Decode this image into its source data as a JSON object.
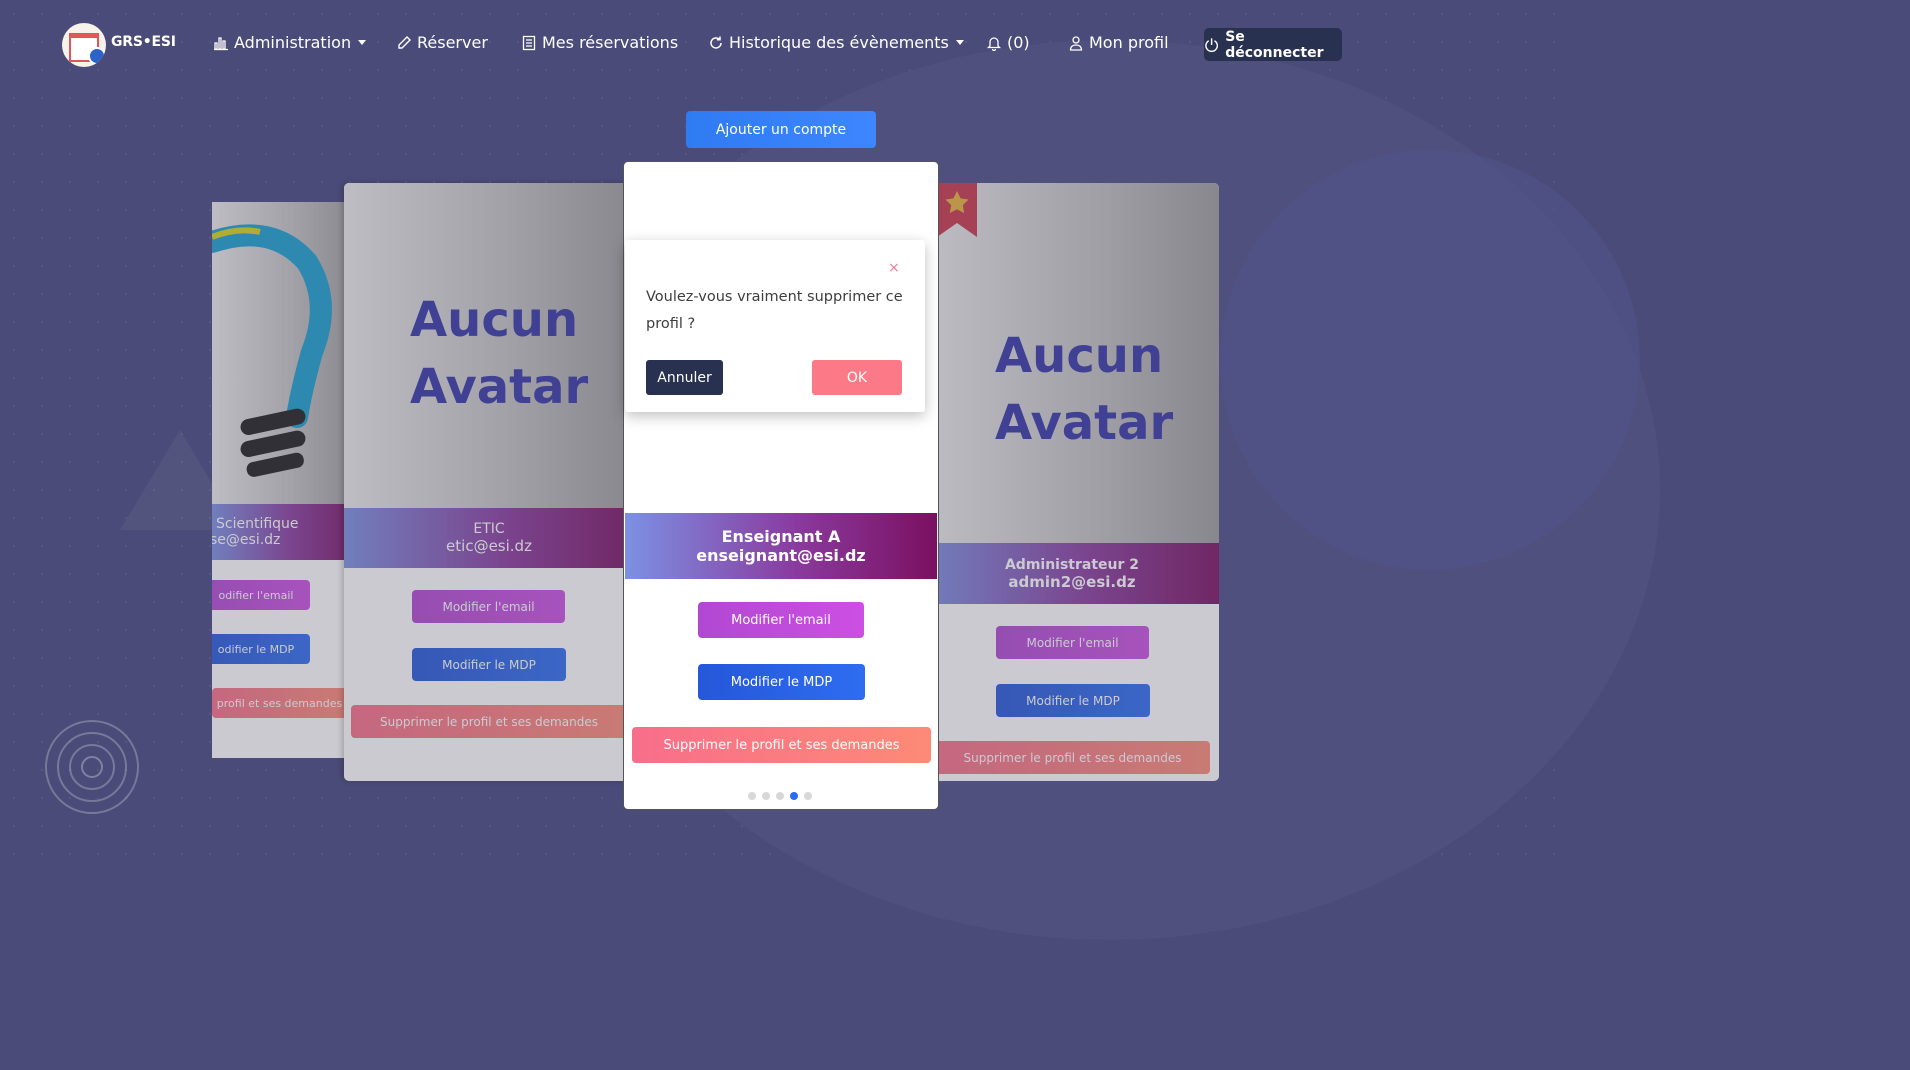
{
  "app": {
    "logo_text": "GRS•ESI"
  },
  "nav": {
    "administration": "Administration",
    "reserver": "Réserver",
    "mes_reservations": "Mes réservations",
    "historique": "Historique des évènements",
    "notifications": "(0)",
    "mon_profil": "Mon profil",
    "logout": "Se déconnecter"
  },
  "add_account_label": "Ajouter un compte",
  "cards": [
    {
      "role": "Scientifique",
      "email": "se@esi.dz",
      "edit_email": "odifier l'email",
      "edit_mdp": "odifier le MDP",
      "delete": "profil et ses demandes"
    },
    {
      "avatar_line1": "Aucun",
      "avatar_line2": "Avatar",
      "role": "ETIC",
      "email": "etic@esi.dz",
      "edit_email": "Modifier l'email",
      "edit_mdp": "Modifier le MDP",
      "delete": "Supprimer le profil et ses demandes"
    },
    {
      "role": "Enseignant A",
      "email": "enseignant@esi.dz",
      "edit_email": "Modifier l'email",
      "edit_mdp": "Modifier le MDP",
      "delete": "Supprimer le profil et ses demandes"
    },
    {
      "avatar_line1": "Aucun",
      "avatar_line2": "Avatar",
      "role": "Administrateur 2",
      "email": "admin2@esi.dz",
      "edit_email": "Modifier l'email",
      "edit_mdp": "Modifier le MDP",
      "delete": "Supprimer le profil et ses demandes"
    }
  ],
  "modal": {
    "close": "×",
    "message": "Voulez-vous vraiment supprimer ce profil ?",
    "cancel": "Annuler",
    "ok": "OK"
  },
  "carousel": {
    "count": 5,
    "active_index": 3
  },
  "colors": {
    "background": "#4a4b78",
    "primary": "#2f7bf2",
    "dark": "#283150",
    "danger": "#fc7a87"
  }
}
